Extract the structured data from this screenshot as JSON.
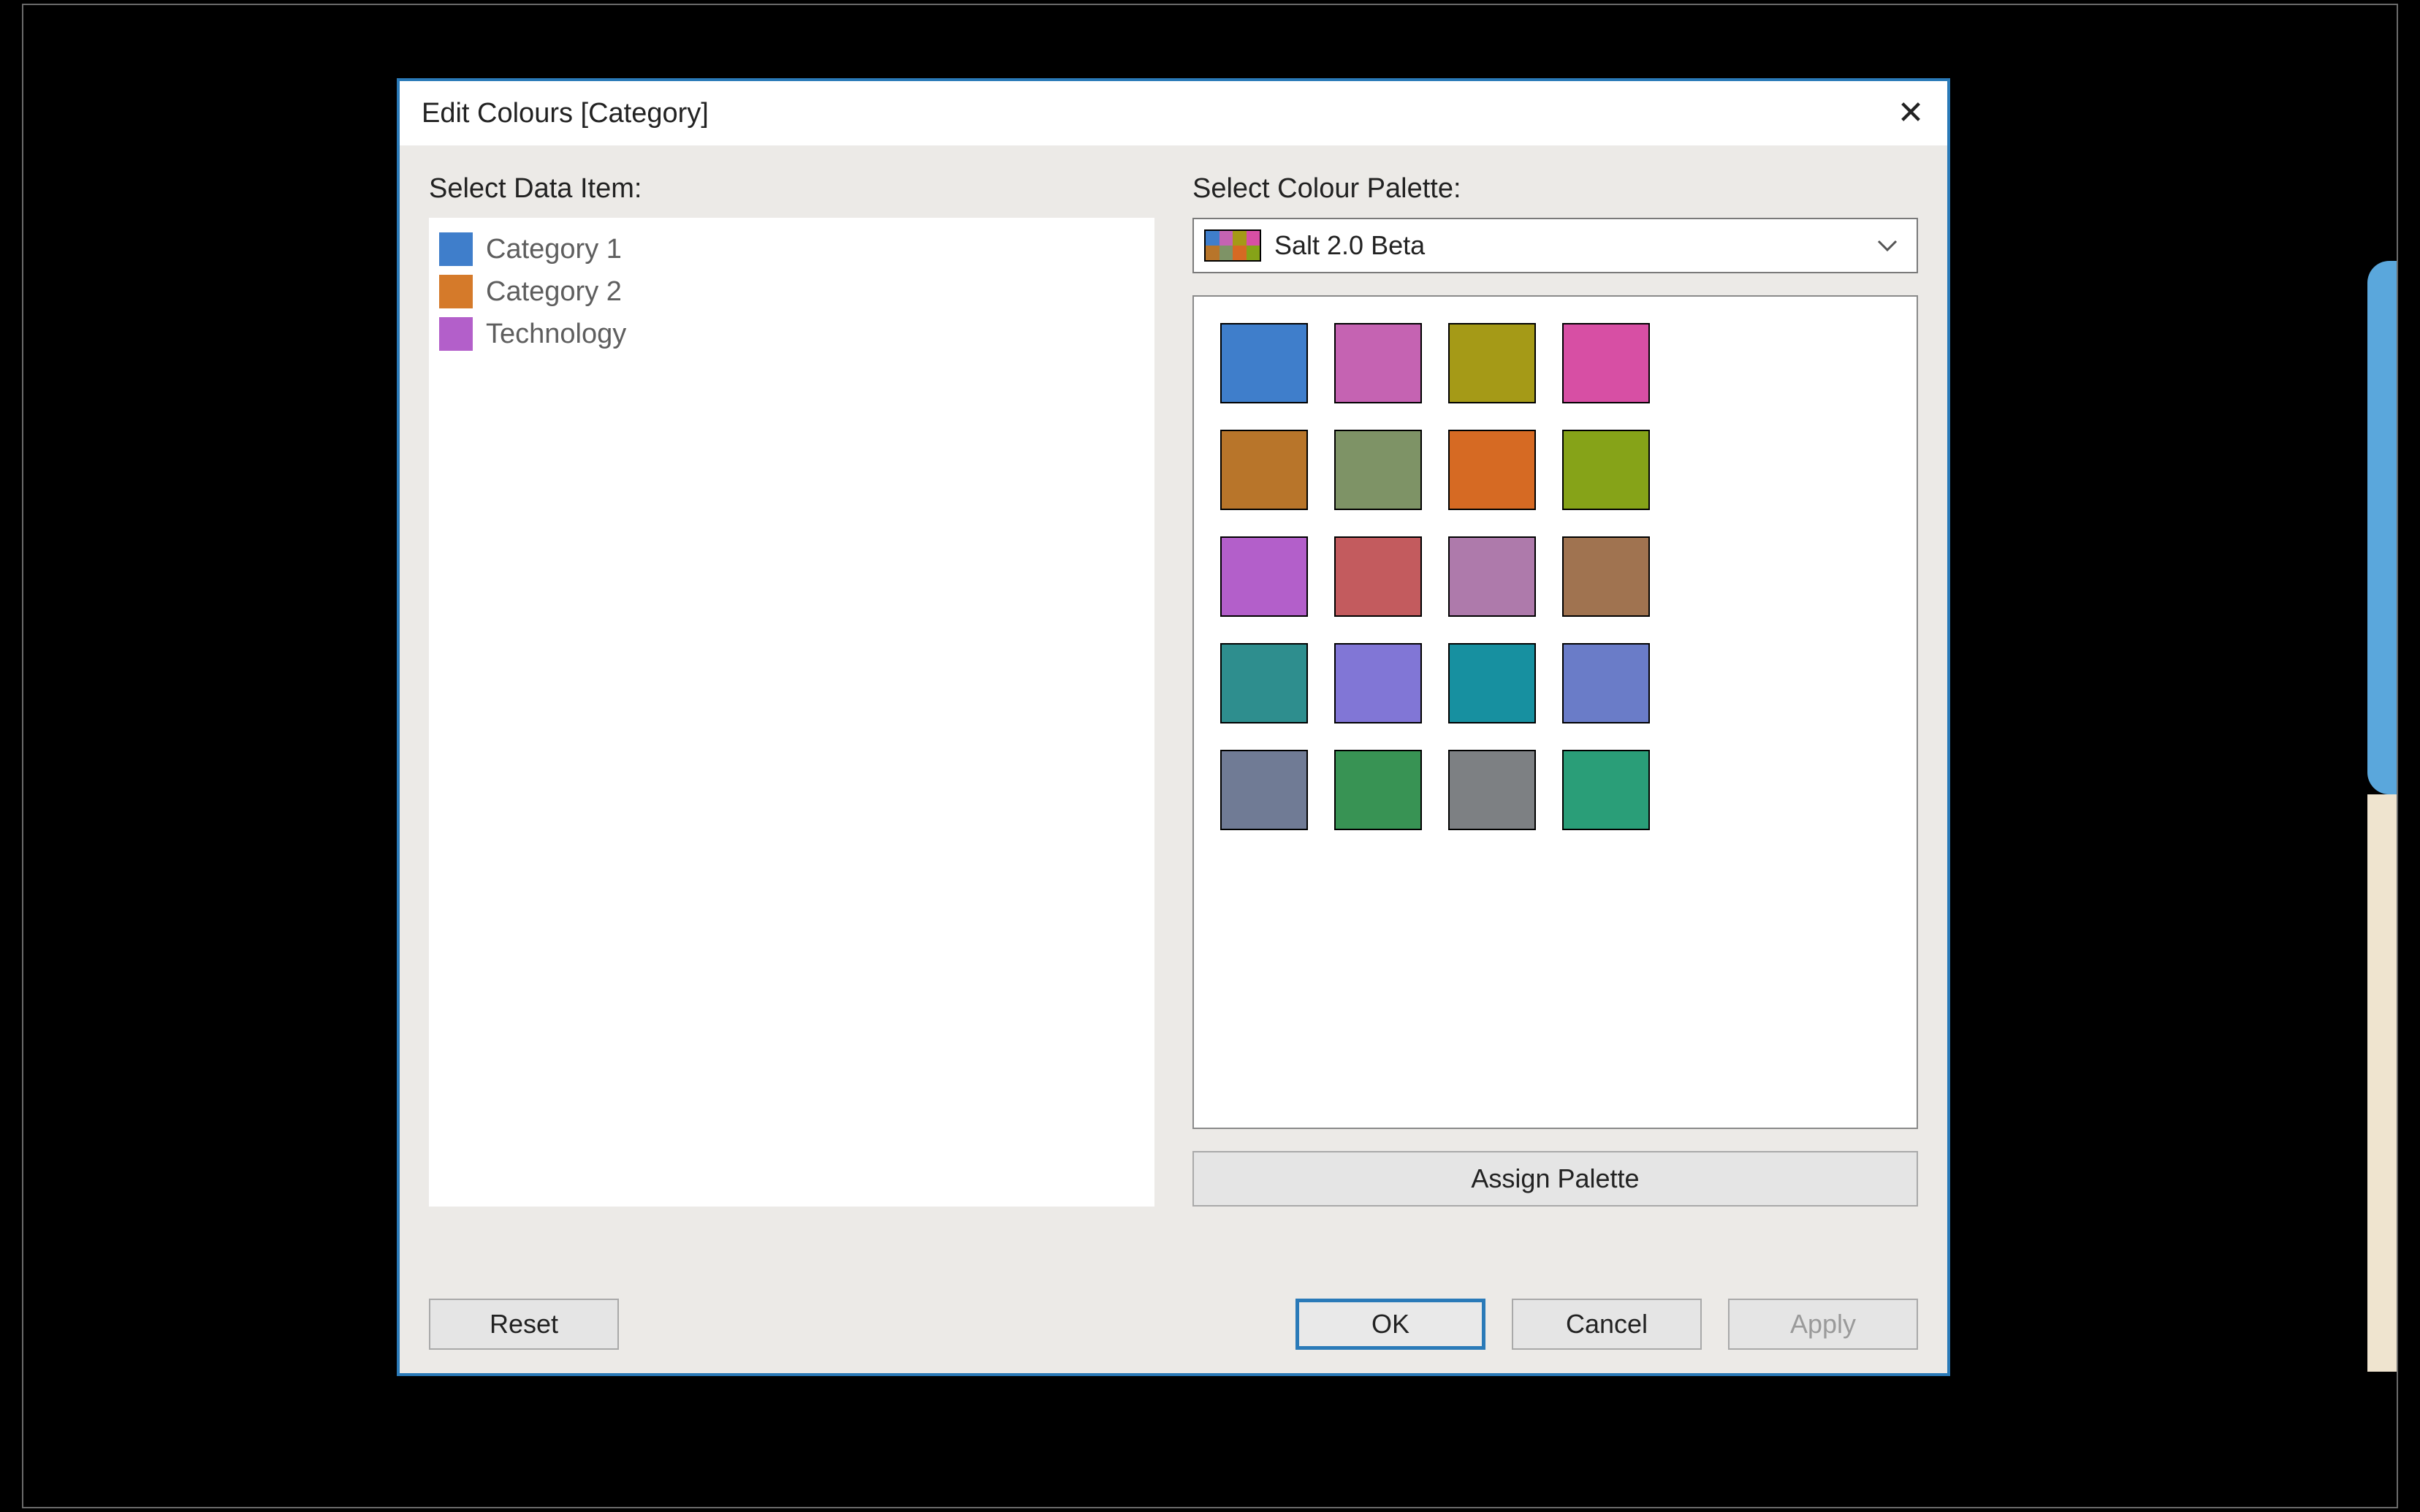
{
  "dialog": {
    "title": "Edit Colours [Category]"
  },
  "left": {
    "label": "Select Data Item:",
    "items": [
      {
        "label": "Category 1",
        "color": "#3f7ecb"
      },
      {
        "label": "Category 2",
        "color": "#d57a2a"
      },
      {
        "label": "Technology",
        "color": "#b35fca"
      }
    ]
  },
  "right": {
    "label": "Select Colour Palette:",
    "palette_selected": "Salt 2.0 Beta",
    "palette_colors": [
      "#3f7ecb",
      "#c563b2",
      "#a59a17",
      "#d74fa4",
      "#b8752a",
      "#7e9366",
      "#d66a23",
      "#86a318",
      "#b35fca",
      "#c35b5e",
      "#ae7aab",
      "#a07350",
      "#2e8e8e",
      "#8176d6",
      "#1790a0",
      "#6a7cc8",
      "#707b95",
      "#389354",
      "#7d8083",
      "#2a9e78"
    ],
    "assign_label": "Assign Palette",
    "thumb_colors": [
      "#3f7ecb",
      "#c563b2",
      "#a59a17",
      "#d74fa4",
      "#b8752a",
      "#7e9366",
      "#d66a23",
      "#86a318"
    ]
  },
  "buttons": {
    "reset": "Reset",
    "ok": "OK",
    "cancel": "Cancel",
    "apply": "Apply"
  }
}
